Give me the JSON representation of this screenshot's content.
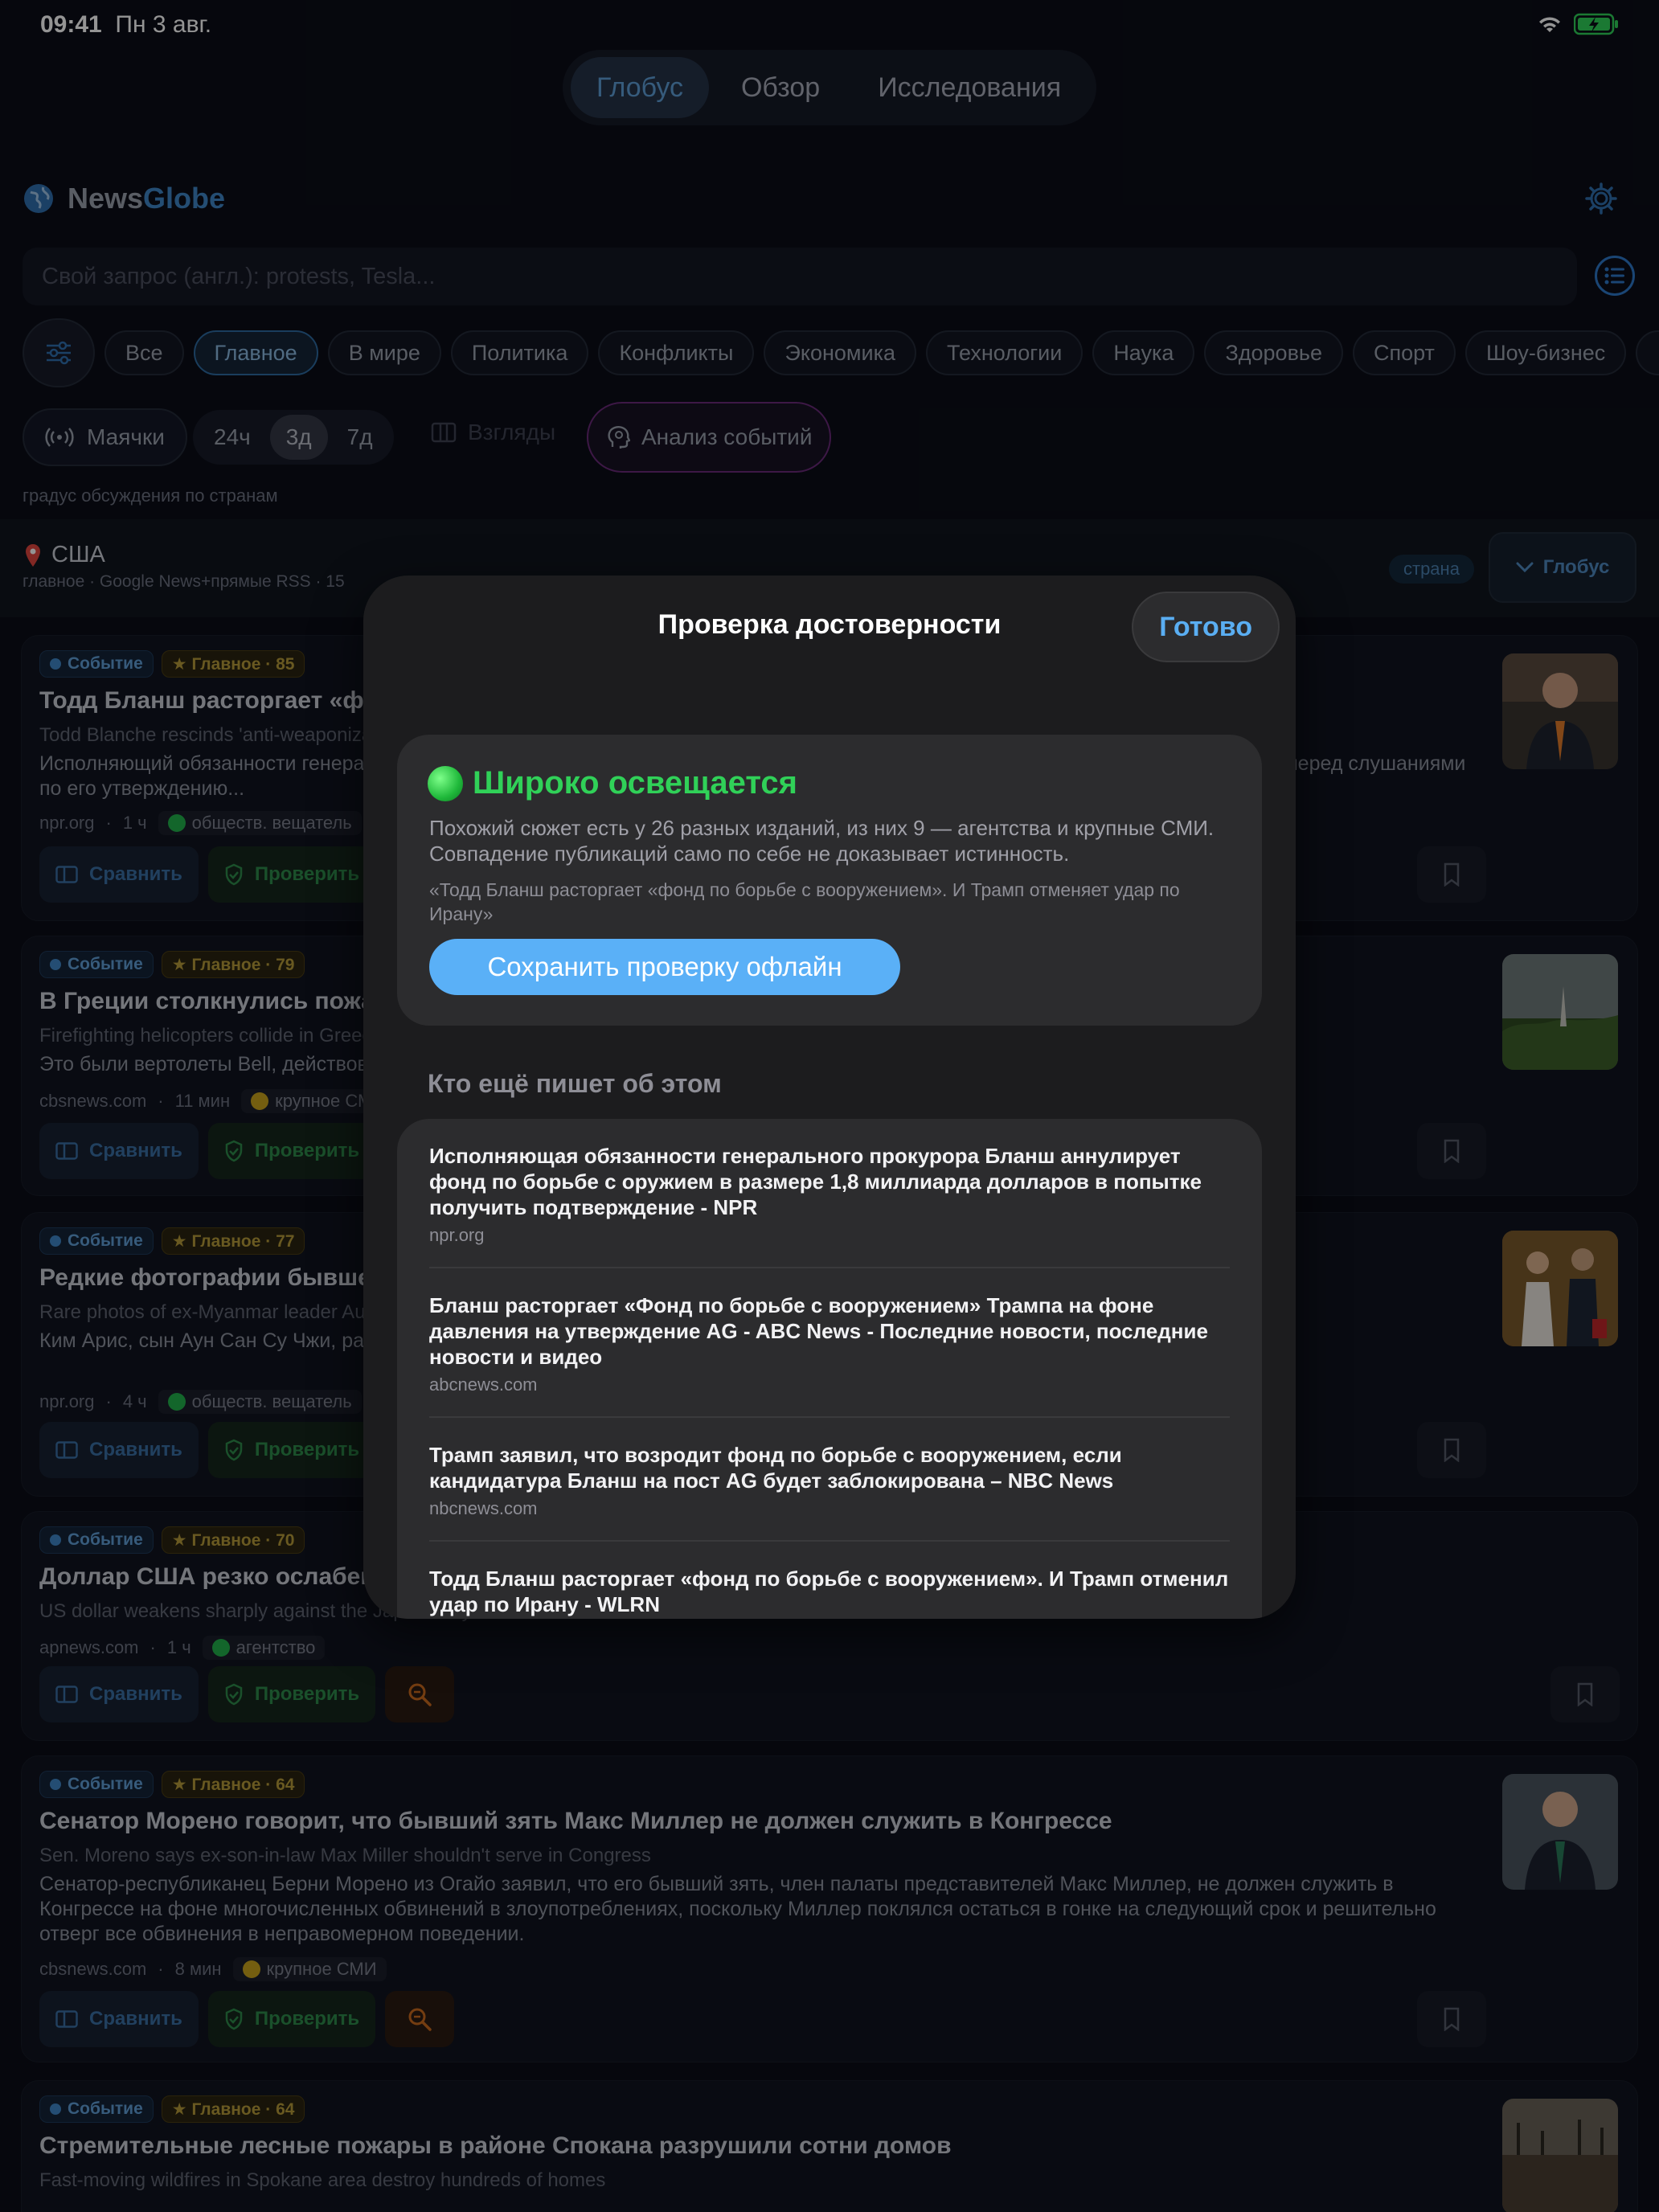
{
  "status": {
    "time": "09:41",
    "date": "Пн 3 авг."
  },
  "tabs": [
    "Глобус",
    "Обзор",
    "Исследования"
  ],
  "app": {
    "name_part1": "News",
    "name_part2": "Globe"
  },
  "search": {
    "placeholder": "Свой запрос (англ.): protests, Tesla..."
  },
  "categories": [
    "Все",
    "Главное",
    "В мире",
    "Политика",
    "Конфликты",
    "Экономика",
    "Технологии",
    "Наука",
    "Здоровье",
    "Спорт",
    "Шоу-бизнес"
  ],
  "controls": {
    "beacons": "Маячки",
    "ranges": [
      "24ч",
      "3д",
      "7д"
    ],
    "views": "Взгляды",
    "analysis": "Анализ событий"
  },
  "hint": "градус обсуждения по странам",
  "country": {
    "name": "США",
    "sub": "главное · Google News+прямые RSS · 15",
    "tag": "страна",
    "globe_button": "Глобус"
  },
  "cards": [
    {
      "badge_event": "Событие",
      "badge_main": "★ Главное · 85",
      "title": "Тодд Бланш расторгает «фонд по борьбе с вооружением». И Трамп отменяет удар по Ирану",
      "sub": "Todd Blanche rescinds 'anti-weaponization fund'. And Trump calls off strike on Iran",
      "desc": "Исполняющий обязанности генерального прокурора Бланш аннулирует фонд, но продолжает добиваться подтверждения. Выступая перед слушаниями по его утверждению...",
      "domain": "npr.org",
      "time": "1 ч",
      "tag": "обществ. вещатель",
      "compare": "Сравнить",
      "verify": "Проверить"
    },
    {
      "badge_event": "Событие",
      "badge_main": "★ Главное · 79",
      "title": "В Греции столкнулись пожарные вертолеты",
      "sub": "Firefighting helicopters collide in Greece",
      "desc": "Это были вертолеты Bell, действовавшие в ходе тушения лесного пожара.",
      "domain": "cbsnews.com",
      "time": "11 мин",
      "tag": "крупное СМИ",
      "compare": "Сравнить",
      "verify": "Проверить"
    },
    {
      "badge_event": "Событие",
      "badge_main": "★ Главное · 77",
      "title": "Редкие фотографии бывшего лидера Мьянмы Аун Сан Су Чжи",
      "sub": "Rare photos of ex-Myanmar leader Aung San Suu Kyi",
      "desc": "Ким Арис, сын Аун Сан Су Чжи, рассказал, что снимки дают «повод для надежды», впервые после военного переворота...",
      "domain": "npr.org",
      "time": "4 ч",
      "tag": "обществ. вещатель",
      "compare": "Сравнить",
      "verify": "Проверить"
    },
    {
      "badge_event": "Событие",
      "badge_main": "★ Главное · 70",
      "title": "Доллар США резко ослабевает по отношению к иене",
      "sub": "US dollar weakens sharply against the Japanese yen",
      "desc": "",
      "domain": "apnews.com",
      "time": "1 ч",
      "tag": "агентство",
      "compare": "Сравнить",
      "verify": "Проверить"
    },
    {
      "badge_event": "Событие",
      "badge_main": "★ Главное · 64",
      "title": "Сенатор Морено говорит, что бывший зять Макс Миллер не должен служить в Конгрессе",
      "sub": "Sen. Moreno says ex-son-in-law Max Miller shouldn't serve in Congress",
      "desc": "Сенатор-республиканец Берни Морено из Огайо заявил, что его бывший зять, член палаты представителей Макс Миллер, не должен служить в Конгрессе на фоне многочисленных обвинений в злоупотреблениях, поскольку Миллер поклялся остаться в гонке на следующий срок и решительно отверг все обвинения в неправомерном поведении.",
      "domain": "cbsnews.com",
      "time": "8 мин",
      "tag": "крупное СМИ",
      "compare": "Сравнить",
      "verify": "Проверить"
    },
    {
      "badge_event": "Событие",
      "badge_main": "★ Главное · 64",
      "title": "Стремительные лесные пожары в районе Спокана разрушили сотни домов",
      "sub": "Fast-moving wildfires in Spokane area destroy hundreds of homes",
      "desc": "",
      "domain": "",
      "time": "",
      "tag": "",
      "compare": "",
      "verify": ""
    }
  ],
  "modal": {
    "title": "Проверка достоверности",
    "done": "Готово",
    "verdict": "Широко освещается",
    "verdict_text": "Похожий сюжет есть у 26 разных изданий, из них 9 — агентства и крупные СМИ. Совпадение публикаций само по себе не доказывает истинность.",
    "quote": "«Тодд Бланш расторгает «фонд по борьбе с вооружением». И Трамп отменяет удар по Ирану»",
    "save_button": "Сохранить проверку офлайн",
    "section_title": "Кто ещё пишет об этом",
    "sources": [
      {
        "title": "Исполняющая обязанности генерального прокурора Бланш аннулирует фонд по борьбе с оружием в размере 1,8 миллиарда долларов в попытке получить подтверждение - NPR",
        "domain": "npr.org"
      },
      {
        "title": "Бланш расторгает «Фонд по борьбе с вооружением» Трампа на фоне давления на утверждение AG - ABC News - Последние новости, последние новости и видео",
        "domain": "abcnews.com"
      },
      {
        "title": "Трамп заявил, что возродит фонд по борьбе с вооружением, если кандидатура Бланш на пост AG будет заблокирована – NBC News",
        "domain": "nbcnews.com"
      },
      {
        "title": "Тодд Бланш расторгает «фонд по борьбе с вооружением». И Трамп отменил удар по Ирану - WLRN",
        "domain": ""
      }
    ]
  }
}
